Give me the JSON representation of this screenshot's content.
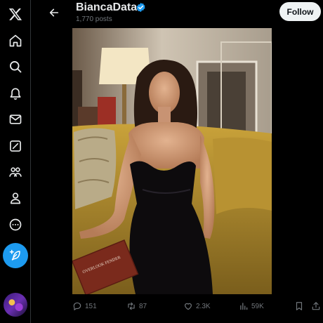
{
  "nav": {
    "items": [
      {
        "name": "x-logo-icon"
      },
      {
        "name": "home-icon"
      },
      {
        "name": "search-icon"
      },
      {
        "name": "notifications-icon"
      },
      {
        "name": "messages-icon"
      },
      {
        "name": "grok-icon"
      },
      {
        "name": "communities-icon"
      },
      {
        "name": "profile-icon"
      },
      {
        "name": "more-icon"
      }
    ],
    "compose_icon": "feather-plus-icon"
  },
  "header": {
    "name": "BiancaData",
    "post_count": "1,770 posts",
    "follow_label": "Follow"
  },
  "post": {
    "image_alt_icon": "photo",
    "book_text": "OVERLOOK FENDER"
  },
  "actions": {
    "replies": "151",
    "reposts": "87",
    "likes": "2.3K",
    "views": "59K"
  },
  "colors": {
    "accent": "#1d9bf0",
    "background": "#000000",
    "muted_text": "#71767b",
    "follow_bg": "#eff3f4"
  }
}
